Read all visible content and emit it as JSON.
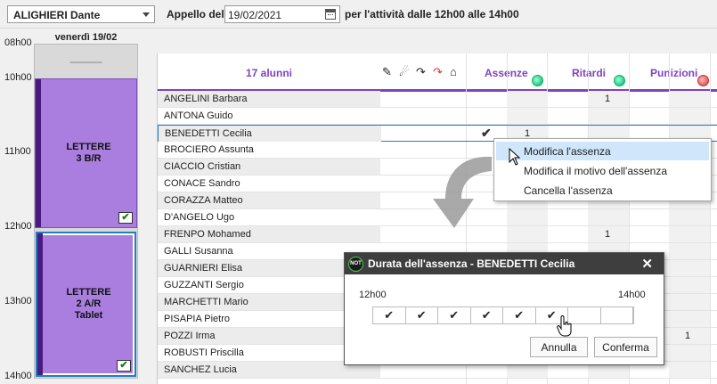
{
  "toolbar": {
    "teacher": "ALIGHIERI Dante",
    "appello_label": "Appello del",
    "date": "19/02/2021",
    "period_label": "per l'attività dalle 12h00 alle 14h00"
  },
  "timeline": {
    "day": "venerdì 19/02",
    "slot_dash": "———",
    "hours": [
      "08h00",
      "10h00",
      "11h00",
      "12h00",
      "13h00",
      "14h00"
    ],
    "lessons": [
      {
        "line1": "LETTERE",
        "line2": "3 B/R",
        "line3": ""
      },
      {
        "line1": "LETTERE",
        "line2": "2 A/R",
        "line3": "Tablet"
      }
    ]
  },
  "grid": {
    "count_label": "17 alunni",
    "columns": {
      "assenze": "Assenze",
      "ritardi": "Ritardi",
      "punizioni": "Punizioni"
    },
    "students": [
      {
        "name": "ANGELINI Barbara",
        "abs": "",
        "late": "1",
        "pun": ""
      },
      {
        "name": "ANTONA Guido",
        "abs": "",
        "late": "",
        "pun": ""
      },
      {
        "name": "BENEDETTI Cecilia",
        "abs": "1",
        "late": "",
        "pun": ""
      },
      {
        "name": "BROCIERO Assunta",
        "abs": "",
        "late": "",
        "pun": ""
      },
      {
        "name": "CIACCIO Cristian",
        "abs": "",
        "late": "",
        "pun": ""
      },
      {
        "name": "CONACE Sandro",
        "abs": "",
        "late": "",
        "pun": ""
      },
      {
        "name": "CORAZZA Matteo",
        "abs": "",
        "late": "",
        "pun": ""
      },
      {
        "name": "D'ANGELO Ugo",
        "abs": "",
        "late": "",
        "pun": ""
      },
      {
        "name": "FRENPO Mohamed",
        "abs": "",
        "late": "1",
        "pun": ""
      },
      {
        "name": "GALLI Susanna",
        "abs": "",
        "late": "",
        "pun": ""
      },
      {
        "name": "GUARNIERI Elisa",
        "abs": "",
        "late": "",
        "pun": ""
      },
      {
        "name": "GUZZANTI Sergio",
        "abs": "",
        "late": "",
        "pun": ""
      },
      {
        "name": "MARCHETTI Mario",
        "abs": "",
        "late": "",
        "pun": ""
      },
      {
        "name": "PISAPIA Pietro",
        "abs": "",
        "late": "",
        "pun": ""
      },
      {
        "name": "POZZI Irma",
        "abs": "",
        "late": "",
        "pun": "1"
      },
      {
        "name": "ROBUSTI Priscilla",
        "abs": "",
        "late": "",
        "pun": ""
      },
      {
        "name": "SANCHEZ Lucia",
        "abs": "",
        "late": "",
        "pun": ""
      }
    ],
    "selected_index": 2
  },
  "context_menu": {
    "items": [
      "Modifica l'assenza",
      "Modifica il motivo dell'assenza",
      "Cancella l'assenza"
    ]
  },
  "dialog": {
    "icon_text": "NOT",
    "title": "Durata dell'assenza - BENEDETTI Cecilia",
    "start": "12h00",
    "end": "14h00",
    "slots": [
      "✔",
      "✔",
      "✔",
      "✔",
      "✔",
      "✔",
      "",
      ""
    ],
    "cancel": "Annulla",
    "confirm": "Conferma"
  },
  "icons": {
    "accent": "#7d43c0",
    "lesson_color": "#a97edf",
    "selection_color": "#2b79c2"
  }
}
